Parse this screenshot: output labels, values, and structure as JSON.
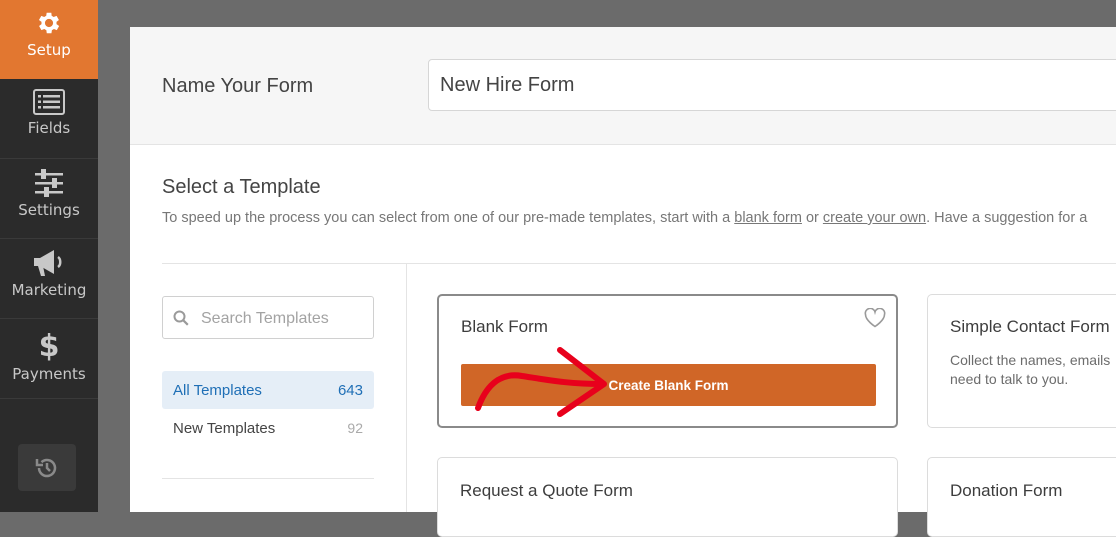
{
  "sidebar": {
    "items": [
      {
        "label": "Setup",
        "icon": "gear-icon"
      },
      {
        "label": "Fields",
        "icon": "list-icon"
      },
      {
        "label": "Settings",
        "icon": "sliders-icon"
      },
      {
        "label": "Marketing",
        "icon": "megaphone-icon"
      },
      {
        "label": "Payments",
        "icon": "dollar-icon"
      }
    ],
    "history_icon": "history-icon",
    "active_color": "#e27730"
  },
  "form_name": {
    "label": "Name Your Form",
    "value": "New Hire Form"
  },
  "templates": {
    "title": "Select a Template",
    "desc_before": "To speed up the process you can select from one of our pre-made templates, start with a ",
    "link_blank": "blank form",
    "desc_or": " or ",
    "link_own": "create your own",
    "desc_after": ". Have a suggestion for a",
    "search_placeholder": "Search Templates",
    "categories": [
      {
        "label": "All Templates",
        "count": "643"
      },
      {
        "label": "New Templates",
        "count": "92"
      }
    ],
    "cards": [
      {
        "title": "Blank Form",
        "button": "Create Blank Form"
      },
      {
        "title": "Simple Contact Form",
        "desc_line1": "Collect the names, emails",
        "desc_line2": "need to talk to you."
      },
      {
        "title": "Request a Quote Form"
      },
      {
        "title": "Donation Form"
      }
    ],
    "button_color": "#d06627",
    "annotation_color": "#e8001c"
  }
}
